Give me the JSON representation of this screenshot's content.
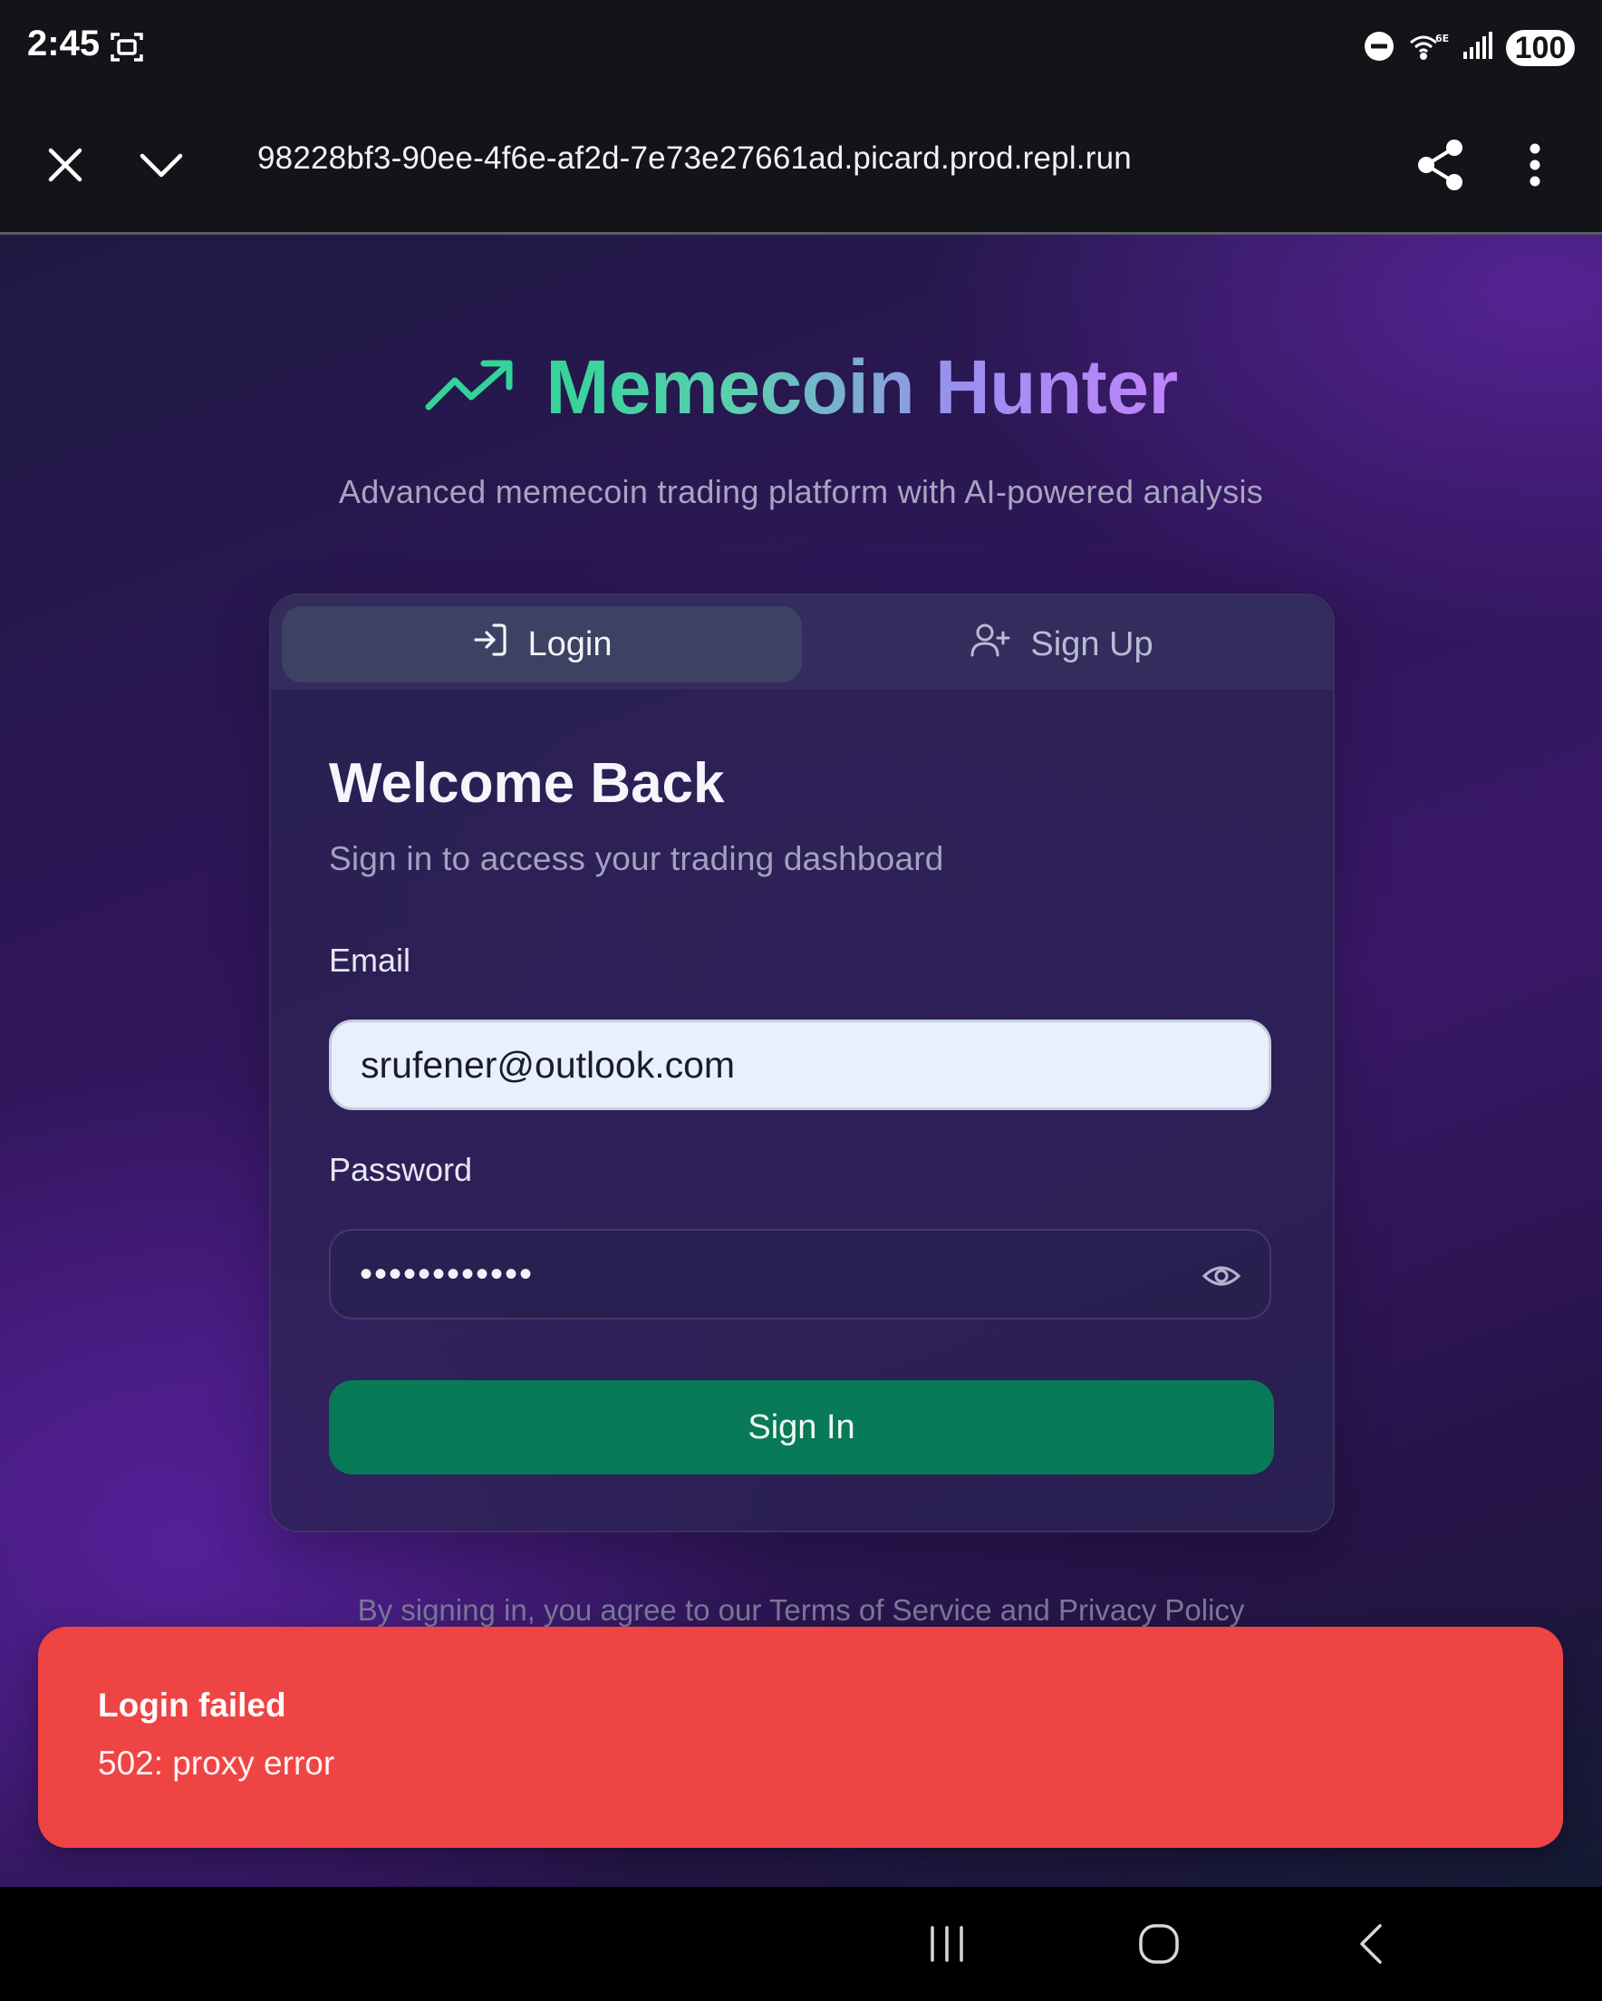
{
  "status_bar": {
    "time": "2:45",
    "battery": "100",
    "icons": [
      "screenshot-icon",
      "do-not-disturb-icon",
      "wifi-6e-icon",
      "signal-icon"
    ]
  },
  "browser": {
    "url": "98228bf3-90ee-4f6e-af2d-7e73e27661ad.picard.prod.repl.run",
    "icons": [
      "close-icon",
      "chevron-down-icon",
      "share-icon",
      "more-vert-icon"
    ]
  },
  "brand": {
    "title": "Memecoin Hunter",
    "tagline": "Advanced memecoin trading platform with AI-powered analysis",
    "icon": "trending-up-icon",
    "colors": {
      "green": "#34d399",
      "purple": "#c084fc"
    }
  },
  "tabs": {
    "login_label": "Login",
    "signup_label": "Sign Up",
    "active": "login"
  },
  "form": {
    "heading": "Welcome Back",
    "subheading": "Sign in to access your trading dashboard",
    "email_label": "Email",
    "email_value": "srufener@outlook.com",
    "password_label": "Password",
    "password_masked": "••••••••••••",
    "submit_label": "Sign In",
    "submit_color": "#087a57"
  },
  "footer": {
    "terms": "By signing in, you agree to our Terms of Service and Privacy Policy"
  },
  "toast": {
    "title": "Login failed",
    "message": "502: proxy error",
    "color": "#ef4444"
  },
  "nav": {
    "icons": [
      "recent-apps-icon",
      "home-icon",
      "back-icon"
    ]
  }
}
